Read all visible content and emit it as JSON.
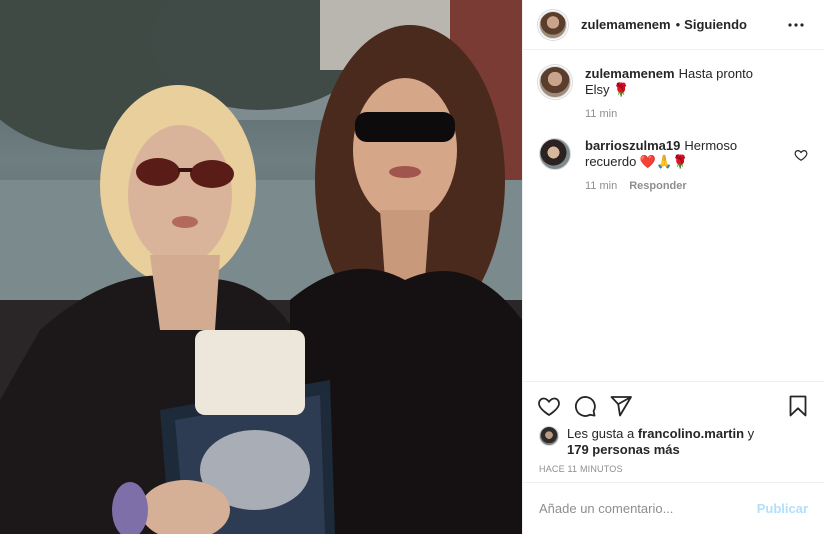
{
  "header": {
    "username": "zulemamenem",
    "separator": "•",
    "follow_status": "Siguiendo",
    "more_icon": "more-horizontal-icon"
  },
  "comments": [
    {
      "username": "zulemamenem",
      "text": "Hasta pronto Elsy 🌹",
      "time": "11 min",
      "reply_label": "",
      "has_like": false
    },
    {
      "username": "barrioszulma19",
      "text": "Hermoso recuerdo ❤️🙏🌹",
      "time": "11 min",
      "reply_label": "Responder",
      "has_like": true
    }
  ],
  "actions": {
    "like_icon": "heart-icon",
    "comment_icon": "comment-bubble-icon",
    "share_icon": "paper-plane-icon",
    "save_icon": "bookmark-icon"
  },
  "likes": {
    "prefix": "Les gusta a",
    "user": "francolino.martin",
    "suffix": "y",
    "others": "179 personas más"
  },
  "timeago": "Hace 11 minutos",
  "add_comment": {
    "placeholder": "Añade un comentario...",
    "publish_label": "Publicar"
  },
  "colors": {
    "text": "#262626",
    "secondary": "#8e8e8e",
    "border": "#efefef",
    "publish_disabled": "#b2dffc"
  }
}
